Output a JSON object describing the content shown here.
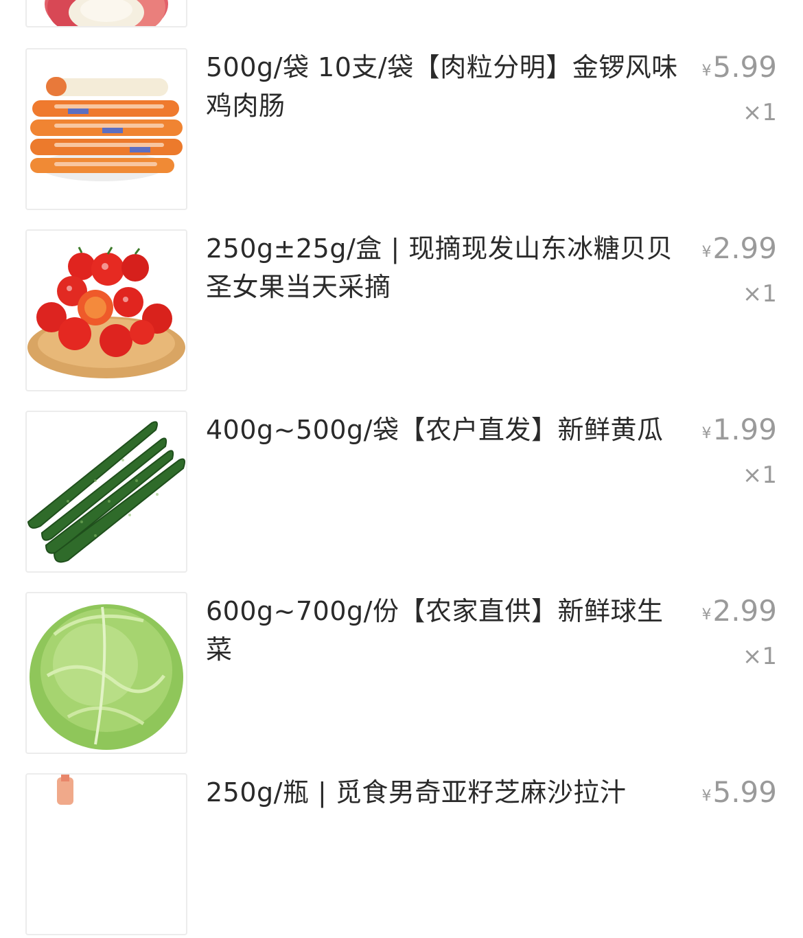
{
  "order_items": [
    {
      "title": "",
      "currency": "",
      "price": "",
      "quantity": "",
      "image_icon": "apple-image"
    },
    {
      "title": "500g/袋 10支/袋【肉粒分明】金锣风味鸡肉肠",
      "currency": "¥",
      "price": "5.99",
      "quantity": "×1",
      "image_icon": "chicken-sausage-image"
    },
    {
      "title": "250g±25g/盒 | 现摘现发山东冰糖贝贝圣女果当天采摘",
      "currency": "¥",
      "price": "2.99",
      "quantity": "×1",
      "image_icon": "cherry-tomatoes-image"
    },
    {
      "title": "400g~500g/袋【农户直发】新鲜黄瓜",
      "currency": "¥",
      "price": "1.99",
      "quantity": "×1",
      "image_icon": "cucumber-image"
    },
    {
      "title": "600g~700g/份【农家直供】新鲜球生菜",
      "currency": "¥",
      "price": "2.99",
      "quantity": "×1",
      "image_icon": "iceberg-lettuce-image"
    },
    {
      "title": "250g/瓶 | 觅食男奇亚籽芝麻沙拉汁",
      "currency": "¥",
      "price": "5.99",
      "quantity": "",
      "image_icon": "salad-dressing-bottle-image"
    }
  ],
  "colors": {
    "title_text": "#2a2a2a",
    "price_text": "#9a9a9a",
    "thumb_border": "#ececec",
    "background": "#ffffff"
  }
}
